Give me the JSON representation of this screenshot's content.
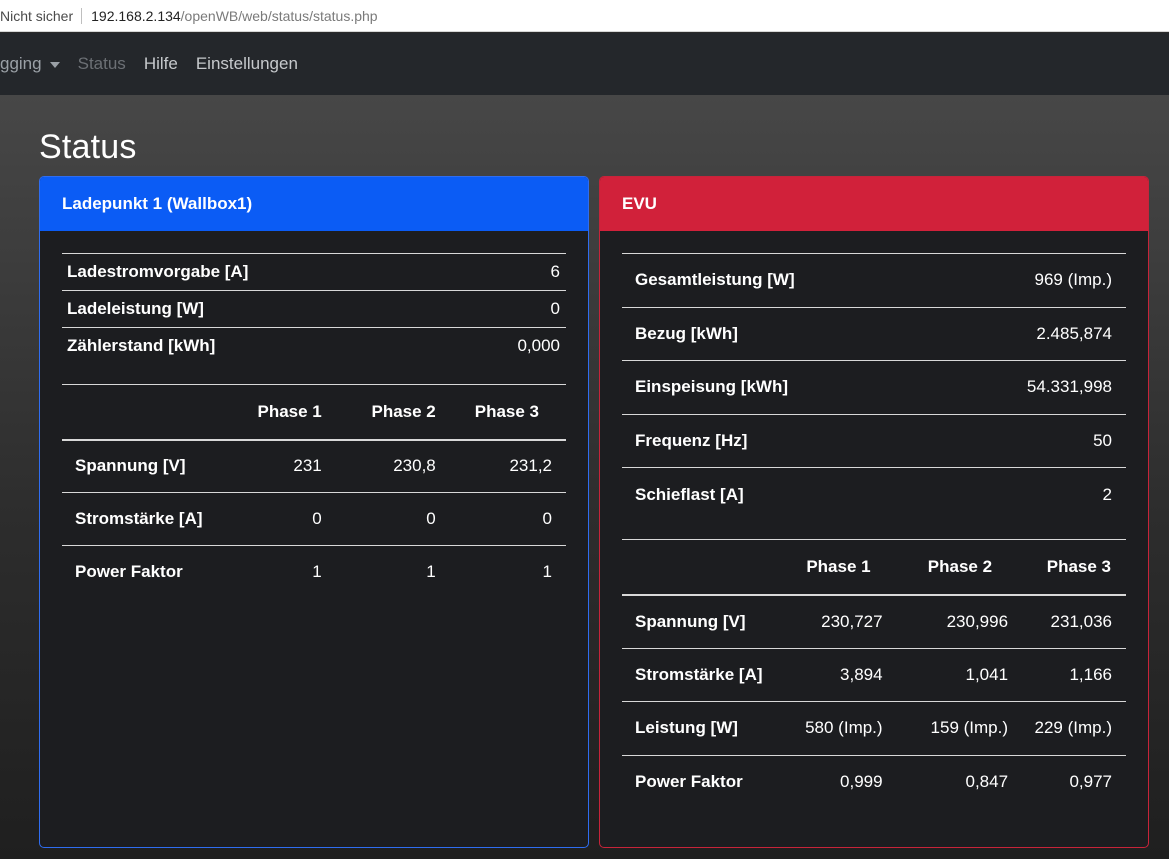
{
  "browser": {
    "security_label": "Nicht sicher",
    "url_host": "192.168.2.134",
    "url_path": "/openWB/web/status/status.php"
  },
  "nav": {
    "logging_label": "gging",
    "status_label": "Status",
    "hilfe_label": "Hilfe",
    "einstellungen_label": "Einstellungen"
  },
  "page": {
    "title": "Status"
  },
  "ladepunkt": {
    "header": "Ladepunkt 1 (Wallbox1)",
    "summary": [
      {
        "label": "Ladestromvorgabe [A]",
        "value": "6"
      },
      {
        "label": "Ladeleistung [W]",
        "value": "0"
      },
      {
        "label": "Zählerstand [kWh]",
        "value": "0,000"
      }
    ],
    "phase_headers": [
      "Phase 1",
      "Phase 2",
      "Phase 3"
    ],
    "phase_rows": [
      {
        "label": "Spannung [V]",
        "values": [
          "231",
          "230,8",
          "231,2"
        ]
      },
      {
        "label": "Stromstärke [A]",
        "values": [
          "0",
          "0",
          "0"
        ]
      },
      {
        "label": "Power Faktor",
        "values": [
          "1",
          "1",
          "1"
        ]
      }
    ]
  },
  "evu": {
    "header": "EVU",
    "summary": [
      {
        "label": "Gesamtleistung [W]",
        "value": "969 (Imp.)"
      },
      {
        "label": "Bezug [kWh]",
        "value": "2.485,874"
      },
      {
        "label": "Einspeisung [kWh]",
        "value": "54.331,998"
      },
      {
        "label": "Frequenz [Hz]",
        "value": "50"
      },
      {
        "label": "Schieflast [A]",
        "value": "2"
      }
    ],
    "phase_headers": [
      "Phase 1",
      "Phase 2",
      "Phase 3"
    ],
    "phase_rows": [
      {
        "label": "Spannung [V]",
        "values": [
          "230,727",
          "230,996",
          "231,036"
        ]
      },
      {
        "label": "Stromstärke [A]",
        "values": [
          "3,894",
          "1,041",
          "1,166"
        ]
      },
      {
        "label": "Leistung [W]",
        "values": [
          "580 (Imp.)",
          "159 (Imp.)",
          "229 (Imp.)"
        ]
      },
      {
        "label": "Power Faktor",
        "values": [
          "0,999",
          "0,847",
          "0,977"
        ]
      }
    ]
  }
}
